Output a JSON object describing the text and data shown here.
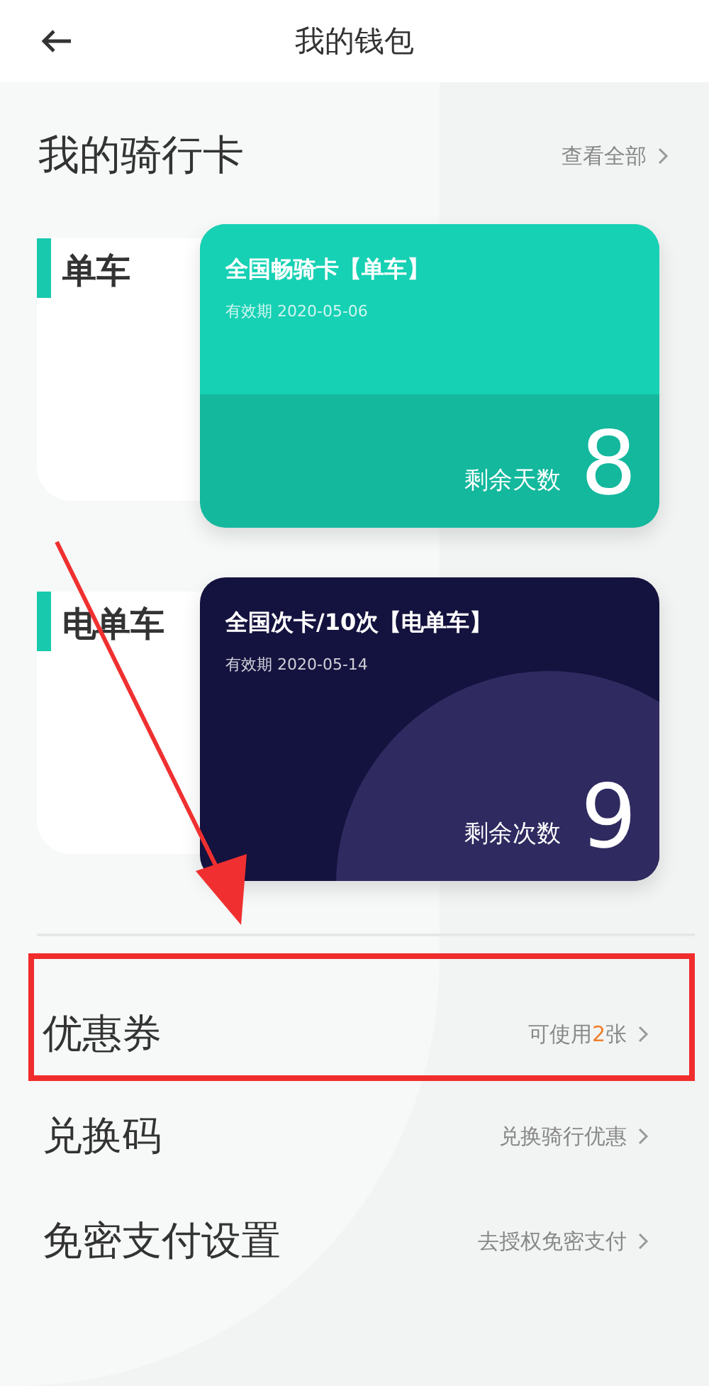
{
  "header": {
    "title": "我的钱包"
  },
  "section": {
    "title": "我的骑行卡",
    "link": "查看全部"
  },
  "cards": [
    {
      "kind": "wave",
      "label": "单车",
      "name": "全国畅骑卡【单车】",
      "validity": "有效期 2020-05-06",
      "remaining_label": "剩余天数",
      "remaining": "8"
    },
    {
      "kind": "circle",
      "label": "电单车",
      "name": "全国次卡/10次【电单车】",
      "validity": "有效期 2020-05-14",
      "remaining_label": "剩余次数",
      "remaining": "9"
    }
  ],
  "rows": [
    {
      "title": "优惠券",
      "detail": [
        {
          "text": "可使用",
          "accent": false
        },
        {
          "text": "2",
          "accent": true
        },
        {
          "text": "张",
          "accent": false
        }
      ],
      "highlighted": true
    },
    {
      "title": "兑换码",
      "detail": [
        {
          "text": "兑换骑行优惠",
          "accent": false
        }
      ],
      "highlighted": false
    },
    {
      "title": "免密支付设置",
      "detail": [
        {
          "text": "去授权免密支付",
          "accent": false
        }
      ],
      "highlighted": false
    }
  ],
  "annotation": {
    "arrow": true
  }
}
